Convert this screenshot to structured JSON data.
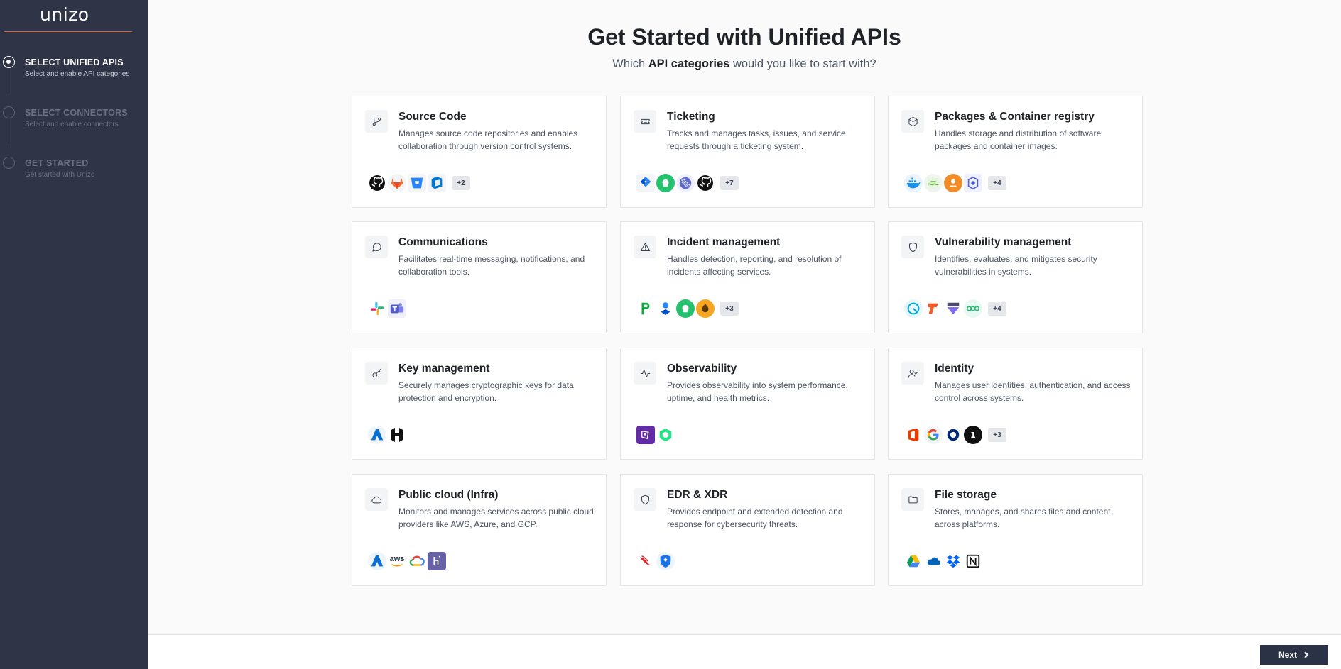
{
  "app": {
    "logo": "unizo"
  },
  "steps": [
    {
      "title": "SELECT UNIFIED APIS",
      "subtitle": "Select and enable API categories",
      "active": true
    },
    {
      "title": "SELECT CONNECTORS",
      "subtitle": "Select and enable connectors",
      "active": false
    },
    {
      "title": "GET STARTED",
      "subtitle": "Get started with Unizo",
      "active": false
    }
  ],
  "header": {
    "title": "Get Started with Unified APIs",
    "subtitle_prefix": "Which ",
    "subtitle_bold": "API categories",
    "subtitle_suffix": " would you like to start with?"
  },
  "categories": [
    {
      "title": "Source Code",
      "description": "Manages source code repositories and enables collaboration through version control systems.",
      "icon": "git-branch-icon",
      "more": "+2"
    },
    {
      "title": "Ticketing",
      "description": "Tracks and manages tasks, issues, and service requests through a ticketing system.",
      "icon": "ticket-icon",
      "more": "+7"
    },
    {
      "title": "Packages & Container registry",
      "description": "Handles storage and distribution of software packages and container images.",
      "icon": "package-icon",
      "more": "+4"
    },
    {
      "title": "Communications",
      "description": "Facilitates real-time messaging, notifications, and collaboration tools.",
      "icon": "message-circle-icon",
      "more": ""
    },
    {
      "title": "Incident management",
      "description": "Handles detection, reporting, and resolution of incidents affecting services.",
      "icon": "alert-triangle-icon",
      "more": "+3"
    },
    {
      "title": "Vulnerability management",
      "description": "Identifies, evaluates, and mitigates security vulnerabilities in systems.",
      "icon": "shield-icon",
      "more": "+4"
    },
    {
      "title": "Key management",
      "description": "Securely manages cryptographic keys for data protection and encryption.",
      "icon": "key-icon",
      "more": ""
    },
    {
      "title": "Observability",
      "description": "Provides observability into system performance, uptime, and health metrics.",
      "icon": "activity-icon",
      "more": ""
    },
    {
      "title": "Identity",
      "description": "Manages user identities, authentication, and access control across systems.",
      "icon": "user-check-icon",
      "more": "+3"
    },
    {
      "title": "Public cloud (Infra)",
      "description": "Monitors and manages services across public cloud providers like AWS, Azure, and GCP.",
      "icon": "cloud-icon",
      "more": ""
    },
    {
      "title": "EDR & XDR",
      "description": "Provides endpoint and extended detection and response for cybersecurity threats.",
      "icon": "shield-icon",
      "more": ""
    },
    {
      "title": "File storage",
      "description": "Stores, manages, and shares files and content across platforms.",
      "icon": "folder-icon",
      "more": ""
    }
  ],
  "logo_labels": {
    "aws": "aws"
  },
  "footer": {
    "next_label": "Next"
  },
  "colors": {
    "sidebar": "#2f3447",
    "accent": "#e0602f",
    "button": "#2b3246"
  }
}
